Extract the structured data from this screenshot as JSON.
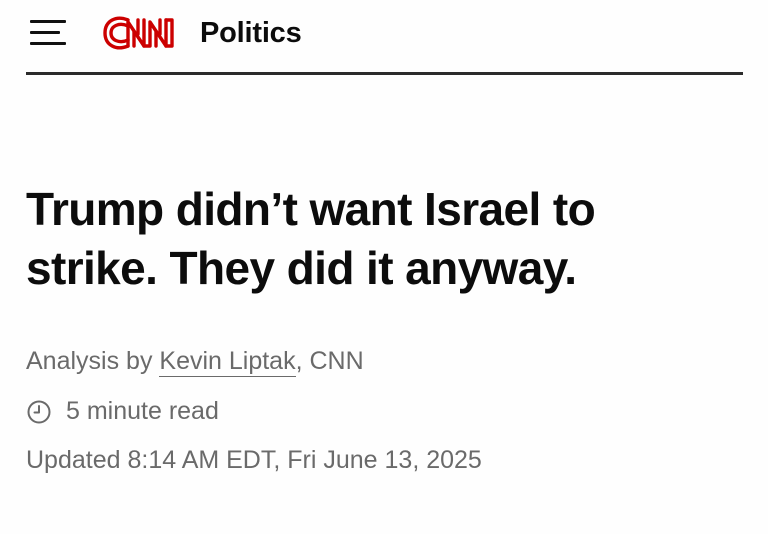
{
  "header": {
    "logo_text": "CNN",
    "section": "Politics"
  },
  "article": {
    "headline": "Trump didn’t want Israel to strike. They did it anyway.",
    "byline_prefix": "Analysis by ",
    "author": "Kevin Liptak",
    "byline_suffix": ", CNN",
    "read_time": "5 minute read",
    "updated": "Updated 8:14 AM EDT, Fri June 13, 2025"
  },
  "icons": {
    "menu": "hamburger-menu-icon",
    "read_time": "clock-icon"
  },
  "colors": {
    "brand_red": "#cc0000",
    "text": "#0c0c0c",
    "meta_text": "#6a6a6a"
  }
}
